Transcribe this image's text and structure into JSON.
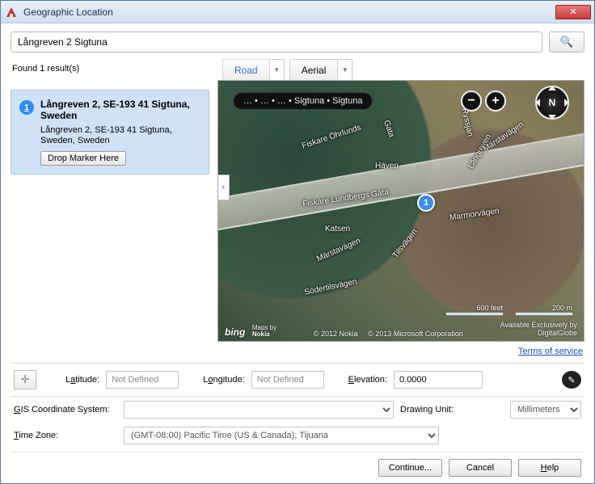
{
  "window": {
    "title": "Geographic Location",
    "close_icon": "✕"
  },
  "search": {
    "value": "Långreven 2 Sigtuna",
    "search_icon": "🔍"
  },
  "results": {
    "found_label": "Found 1 result(s)",
    "items": [
      {
        "badge": "1",
        "title": "Långreven 2, SE-193 41 Sigtuna, Sweden",
        "sub": "Långreven 2, SE-193 41 Sigtuna, Sweden, Sweden",
        "drop_label": "Drop Marker Here"
      }
    ]
  },
  "map_tabs": {
    "road": "Road",
    "aerial": "Aerial"
  },
  "map": {
    "breadcrumb": "… • … • … • Sigtuna • Sigtuna",
    "compass": "N",
    "pin": "1",
    "streets": {
      "ohrlunds": "Fiskare Öhrlunds",
      "gata": "Gata",
      "haven": "Häven",
      "ryssjan": "Ryssjan",
      "langreven": "Långreven",
      "marstavagen1": "Märstavägen",
      "lundbergs": "Fiskare Lundbergs Gata",
      "marmor": "Marmorvägen",
      "marstavagen2": "Märstavägen",
      "tilsvagen": "Tilsvägen",
      "katsen": "Katsen",
      "soder": "Södertilsvägen"
    },
    "scale": {
      "feet": "600 feet",
      "meters": "200 m"
    },
    "credits": {
      "bing": "bing",
      "nokia_label": "Maps by",
      "nokia": "Nokia",
      "copyright1": "© 2012 Nokia",
      "copyright2": "© 2013 Microsoft Corporation",
      "exclusive1": "Available Exclusively by",
      "exclusive2": "DigitalGlobe"
    }
  },
  "terms": "Terms of service",
  "coords": {
    "pick_icon": "✛",
    "lat_label_pre": "L",
    "lat_label_ul": "a",
    "lat_label_post": "titude:",
    "lat_value": "Not Defined",
    "lon_label_pre": "L",
    "lon_label_ul": "o",
    "lon_label_post": "ngitude:",
    "lon_value": "Not Defined",
    "elev_label_pre": "",
    "elev_label_ul": "E",
    "elev_label_post": "levation:",
    "elev_value": "0.0000",
    "edit_icon": "✎"
  },
  "gis": {
    "label_pre": "",
    "label_ul": "G",
    "label_post": "IS Coordinate System:",
    "value": "",
    "unit_label": "Drawing Unit:",
    "unit_value": "Millimeters"
  },
  "tz": {
    "label_pre": "",
    "label_ul": "T",
    "label_post": "ime Zone:",
    "value": "(GMT-08:00) Pacific Time (US & Canada); Tijuana"
  },
  "buttons": {
    "continue": "Continue...",
    "cancel": "Cancel",
    "help_pre": "",
    "help_ul": "H",
    "help_post": "elp"
  }
}
